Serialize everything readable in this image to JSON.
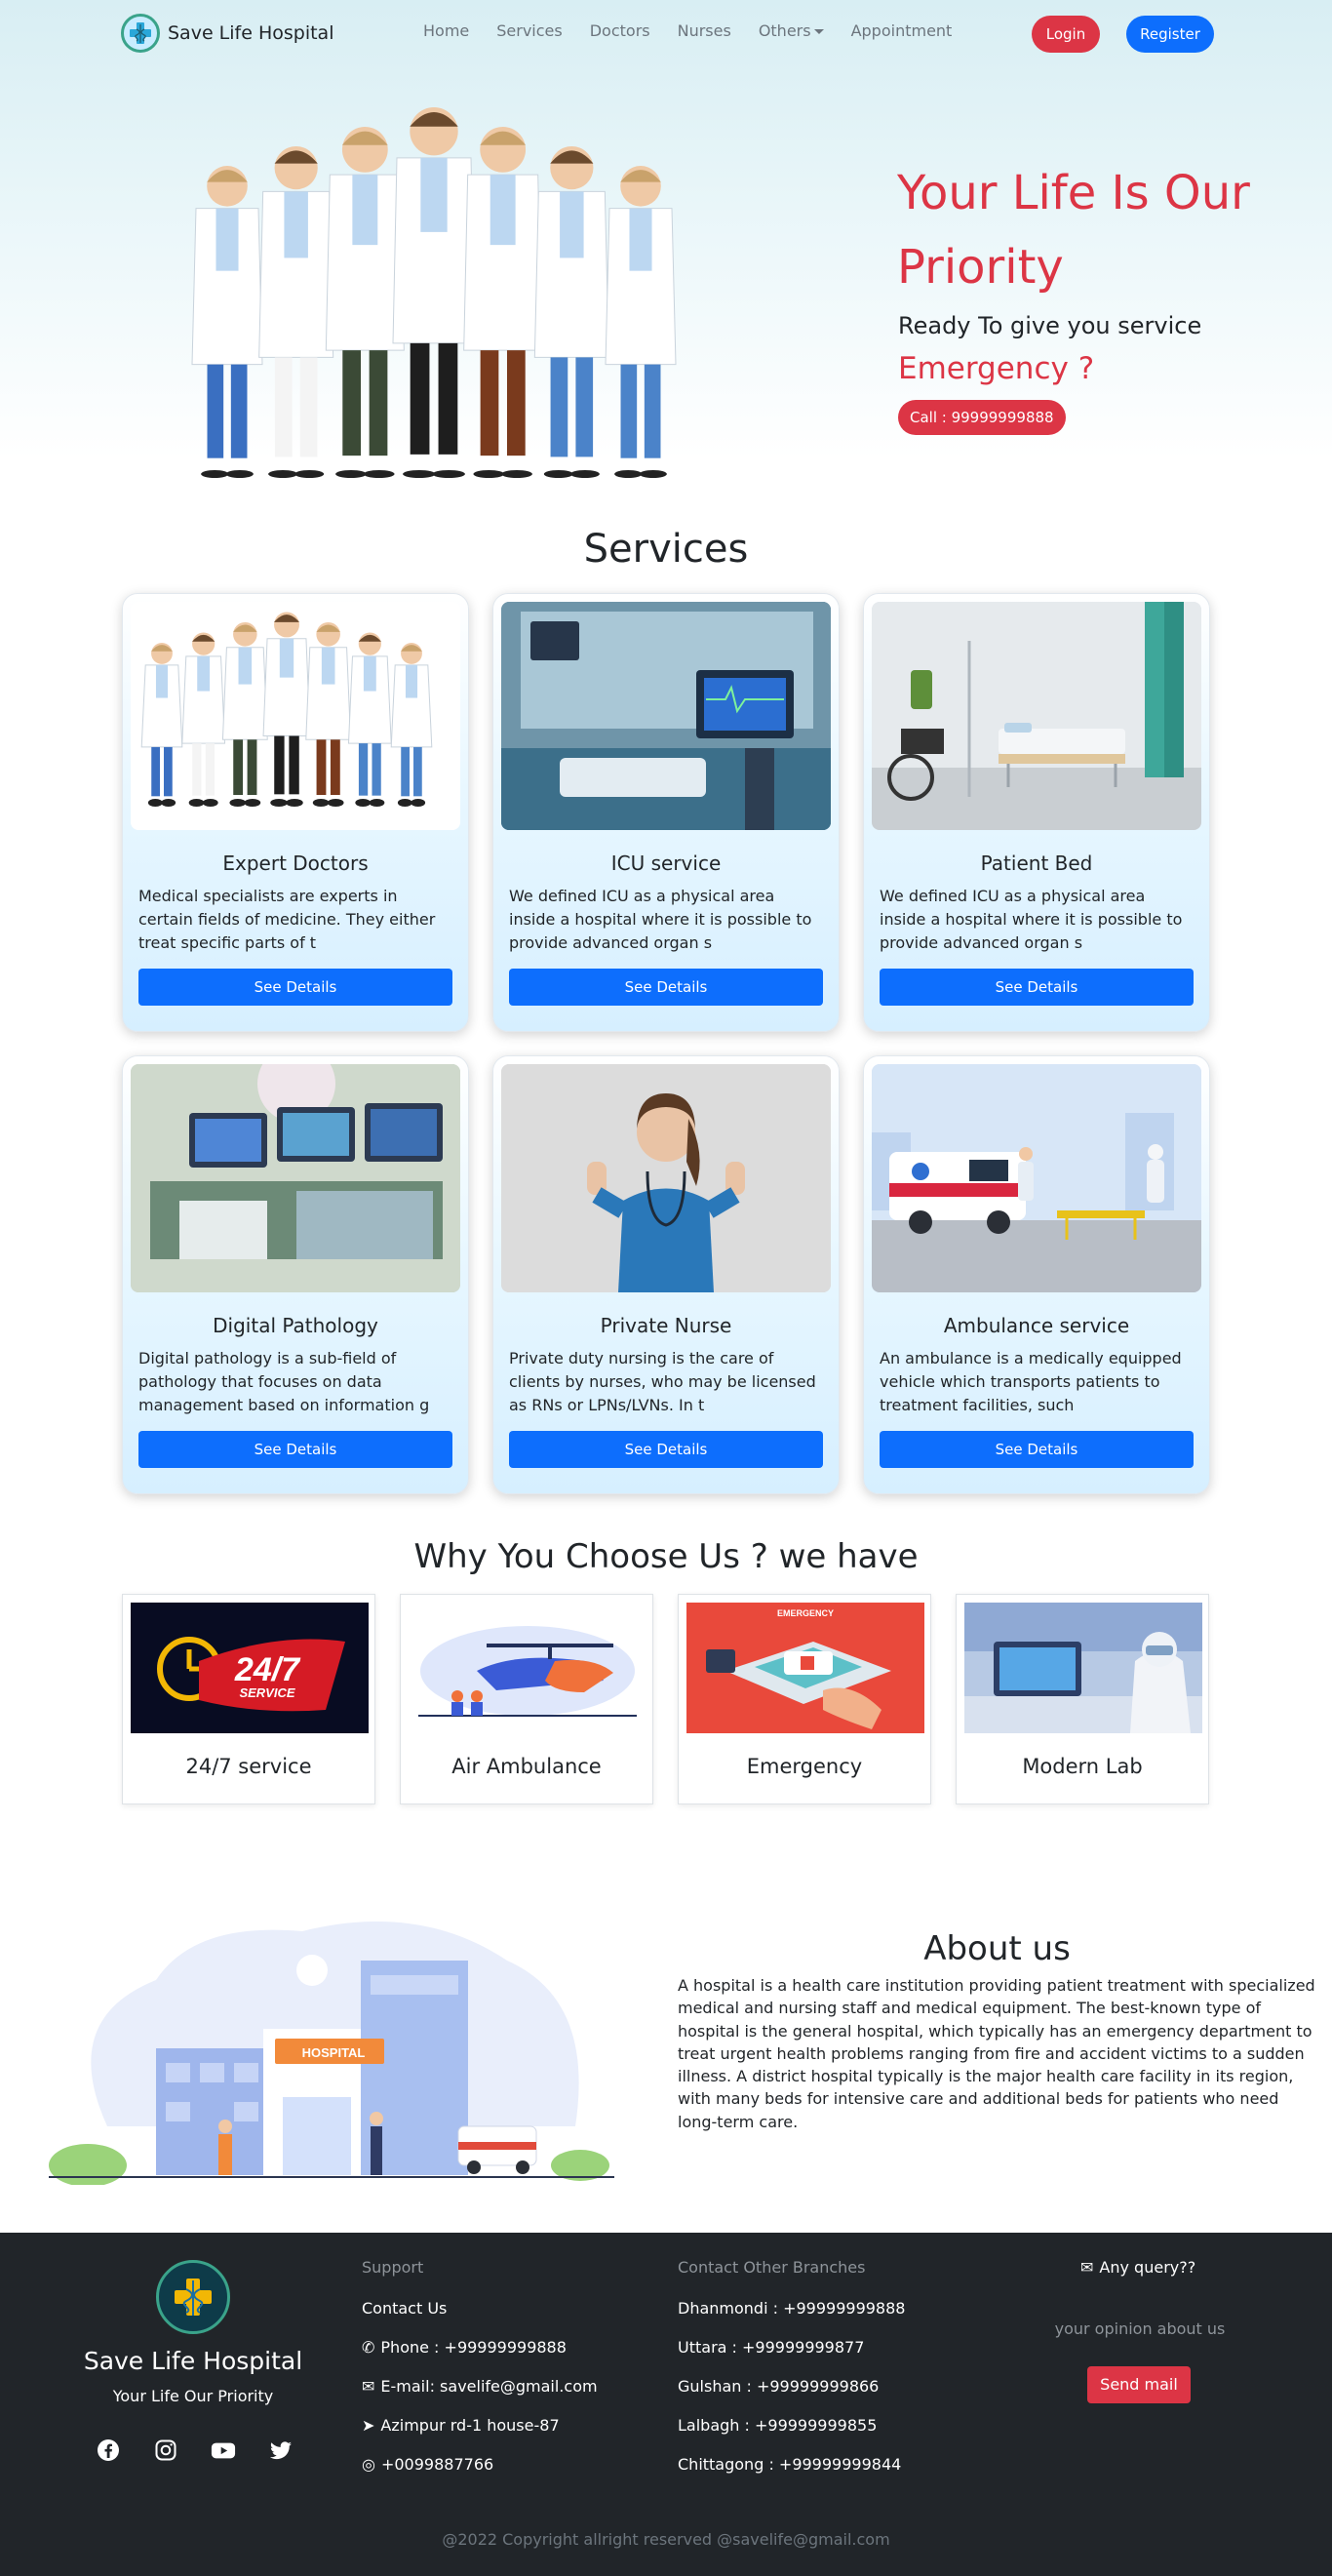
{
  "nav": {
    "brand": "Save Life Hospital",
    "links": [
      "Home",
      "Services",
      "Doctors",
      "Nurses",
      "Others",
      "Appointment"
    ],
    "login": "Login",
    "register": "Register"
  },
  "hero": {
    "title": "Your Life Is Our Priority",
    "subtitle": "Ready To give you service",
    "emergency": "Emergency ?",
    "call": "Call : 99999999888"
  },
  "services": {
    "title": "Services",
    "cards": [
      {
        "title": "Expert Doctors",
        "desc": "Medical specialists are experts in certain fields of medicine. They either treat specific parts of t",
        "button": "See Details"
      },
      {
        "title": "ICU service",
        "desc": "We defined ICU as a physical area inside a hospital where it is possible to provide advanced organ s",
        "button": "See Details"
      },
      {
        "title": "Patient Bed",
        "desc": "We defined ICU as a physical area inside a hospital where it is possible to provide advanced organ s",
        "button": "See Details"
      },
      {
        "title": "Digital Pathology",
        "desc": "Digital pathology is a sub-field of pathology that focuses on data management based on information g",
        "button": "See Details"
      },
      {
        "title": "Private Nurse",
        "desc": "Private duty nursing is the care of clients by nurses, who may be licensed as RNs or LPNs/LVNs. In t",
        "button": "See Details"
      },
      {
        "title": "Ambulance service",
        "desc": "An ambulance is a medically equipped vehicle which transports patients to treatment facilities, such",
        "button": "See Details"
      }
    ]
  },
  "why": {
    "title": "Why You Choose Us ? we have",
    "items": [
      {
        "label": "24/7 service",
        "badge_big": "24/7",
        "badge_small": "SERVICE"
      },
      {
        "label": "Air Ambulance"
      },
      {
        "label": "Emergency",
        "banner": "EMERGENCY"
      },
      {
        "label": "Modern Lab"
      }
    ]
  },
  "about": {
    "title": "About us",
    "text": "A hospital is a health care institution providing patient treatment with specialized medical and nursing staff and medical equipment. The best-known type of hospital is the general hospital, which typically has an emergency department to treat urgent health problems ranging from fire and accident victims to a sudden illness. A district hospital typically is the major health care facility in its region, with many beds for intensive care and additional beds for patients who need long-term care.",
    "sign": "HOSPITAL"
  },
  "footer": {
    "name": "Save Life Hospital",
    "tagline": "Your Life Our Priority",
    "support": {
      "heading": "Support",
      "contact": "Contact Us",
      "phone": "Phone : +99999999888",
      "email": "E-mail: savelife@gmail.com",
      "address": "Azimpur rd-1 house-87",
      "whatsapp": "+0099887766"
    },
    "branches": {
      "heading": "Contact Other Branches",
      "items": [
        "Dhanmondi : +99999999888",
        "Uttara : +99999999877",
        "Gulshan : +99999999866",
        "Lalbagh : +99999999855",
        "Chittagong : +99999999844"
      ]
    },
    "query": "Any query??",
    "opinion_placeholder": "your opinion about us",
    "send": "Send mail",
    "copyright": "@2022 Copyright allright reserved @savelife@gmail.com"
  },
  "icons": {
    "caduceus": "caduceus-icon",
    "phone": "phone-icon",
    "envelope": "envelope-icon",
    "location": "location-arrow-icon",
    "whatsapp": "whatsapp-icon",
    "facebook": "facebook-icon",
    "instagram": "instagram-icon",
    "youtube": "youtube-icon",
    "twitter": "twitter-icon"
  },
  "colors": {
    "primary": "#0d6efd",
    "danger": "#dc3545",
    "footer": "#212529"
  }
}
